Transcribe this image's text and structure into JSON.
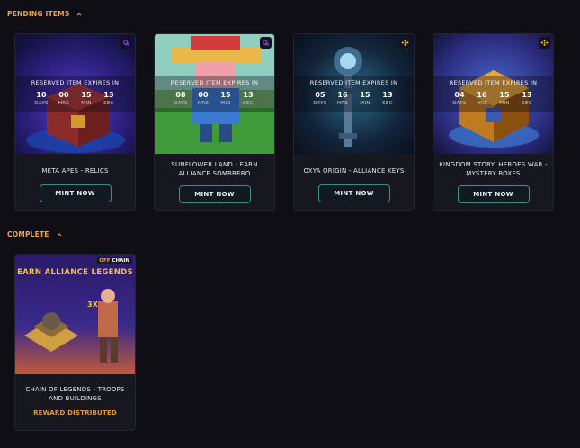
{
  "sections": {
    "pending": {
      "title": "PENDING ITEMS"
    },
    "complete": {
      "title": "COMPLETE"
    }
  },
  "countdown_labels": {
    "title": "RESERVED ITEM EXPIRES IN",
    "days": "DAYS",
    "hrs": "HRS",
    "min": "MIN",
    "sec": "SEC"
  },
  "pending_items": [
    {
      "title": "META APES - RELICS",
      "days": "10",
      "hrs": "00",
      "min": "15",
      "sec": "13",
      "button": "MINT NOW",
      "chain_icon": "polygon-icon",
      "chain_color": "#8247e5"
    },
    {
      "title": "SUNFLOWER LAND - EARN ALLIANCE SOMBRERO",
      "days": "08",
      "hrs": "00",
      "min": "15",
      "sec": "13",
      "button": "MINT NOW",
      "chain_icon": "polygon-icon",
      "chain_color": "#8247e5"
    },
    {
      "title": "OXYA ORIGIN - ALLIANCE KEYS",
      "days": "05",
      "hrs": "16",
      "min": "15",
      "sec": "13",
      "button": "MINT NOW",
      "chain_icon": "bnb-icon",
      "chain_color": "#f3ba2f"
    },
    {
      "title": "KINGDOM STORY: HEROES WAR - MYSTERY BOXES",
      "days": "04",
      "hrs": "16",
      "min": "15",
      "sec": "13",
      "button": "MINT NOW",
      "chain_icon": "bnb-icon",
      "chain_color": "#f3ba2f"
    }
  ],
  "complete_items": [
    {
      "title": "CHAIN OF LEGENDS - TROOPS AND BUILDINGS",
      "status": "REWARD DISTRIBUTED",
      "badge_off": "OFF",
      "badge_chain": "CHAIN",
      "art_title": "EARN ALLIANCE LEGENDS",
      "art_multiplier": "3X"
    }
  ],
  "colors": {
    "accent": "#f0a15a",
    "button_border": "#3f8d8f",
    "background": "#0e0e14"
  }
}
